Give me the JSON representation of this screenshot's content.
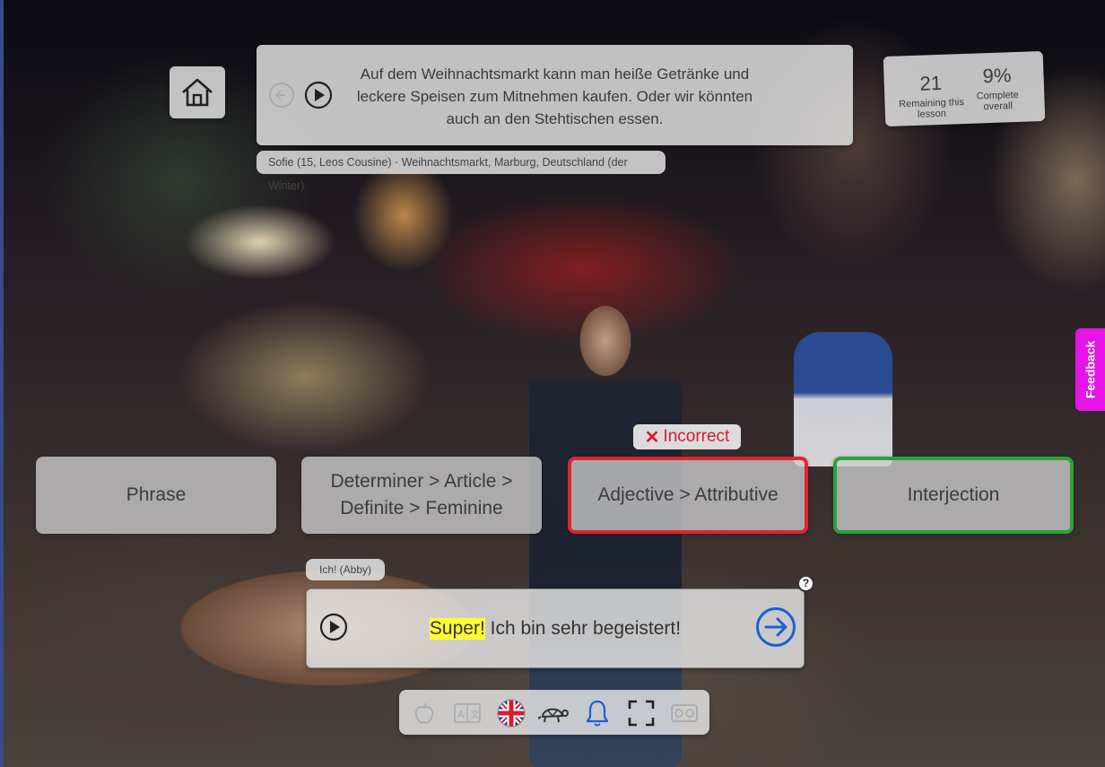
{
  "dialog": {
    "text": "Auf dem Weihnachtsmarkt kann man heiße Getränke und leckere Speisen zum Mitnehmen kaufen. Oder wir könnten auch an den Stehtischen essen.",
    "speaker": "Sofie (15, Leos Cousine) · Weihnachtsmarkt, Marburg, Deutschland (der Winter)"
  },
  "stats": {
    "remaining_value": "21",
    "remaining_label": "Remaining this lesson",
    "complete_value": "9%",
    "complete_label": "Complete overall"
  },
  "choices": [
    {
      "label": "Phrase",
      "state": "neutral"
    },
    {
      "label": "Determiner > Article > Definite > Feminine",
      "state": "neutral"
    },
    {
      "label": "Adjective > Attributive",
      "state": "incorrect"
    },
    {
      "label": "Interjection",
      "state": "correct"
    }
  ],
  "feedback_badge": {
    "label": "Incorrect",
    "color": "#d61f2b"
  },
  "reply": {
    "tag": "Ich! (Abby)",
    "highlighted": "Super!",
    "rest": " Ich bin sehr begeistert!"
  },
  "toolbar": {
    "icons": [
      "apple-icon",
      "translate-icon",
      "uk-flag-icon",
      "turtle-icon",
      "bell-icon",
      "fullscreen-icon",
      "vr-headset-icon"
    ]
  },
  "feedback_tab": {
    "label": "Feedback",
    "color": "#e614e6"
  },
  "colors": {
    "correct": "#2ba23a",
    "incorrect": "#e02430",
    "accent_blue": "#1a5fd6",
    "highlight": "#ffff33"
  }
}
